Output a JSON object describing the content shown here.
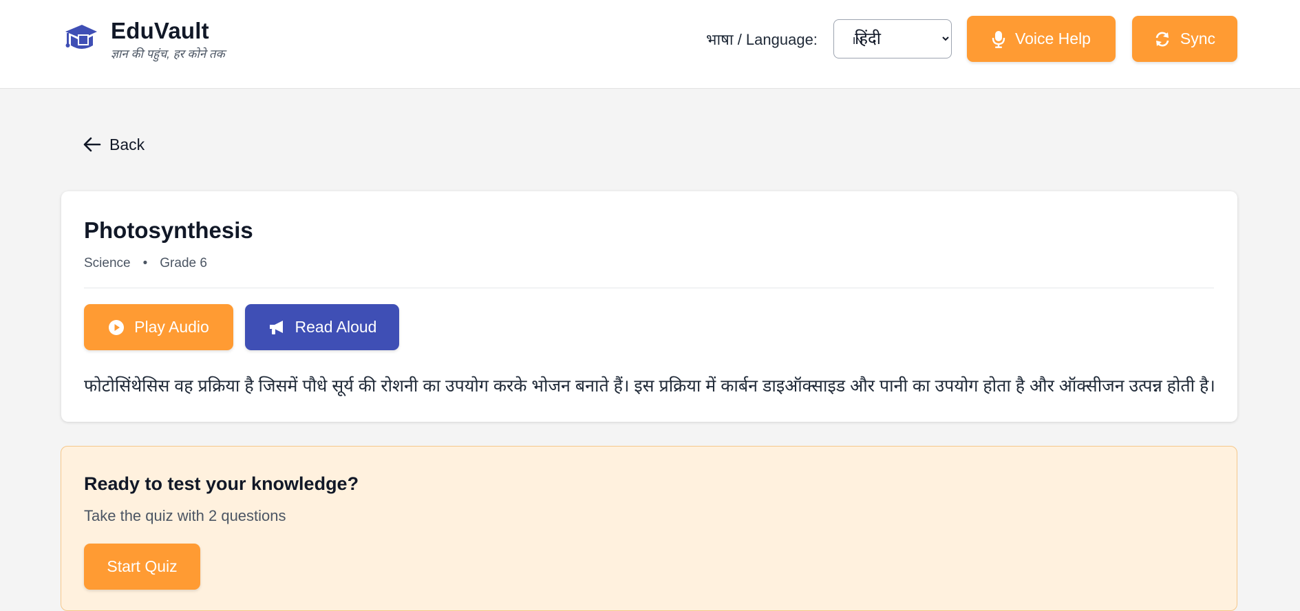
{
  "header": {
    "brand_name": "EduVault",
    "brand_tagline": "ज्ञान की पहुंच, हर कोने तक",
    "language_label": "भाषा / Language:",
    "language_flag": "IN",
    "language_selected": "हिंदी",
    "voice_help_label": "Voice Help",
    "sync_label": "Sync"
  },
  "nav": {
    "back_label": "Back"
  },
  "lesson": {
    "title": "Photosynthesis",
    "subject": "Science",
    "separator": "•",
    "grade": "Grade 6",
    "play_audio_label": "Play Audio",
    "read_aloud_label": "Read Aloud",
    "body": "फोटोसिंथेसिस वह प्रक्रिया है जिसमें पौधे सूर्य की रोशनी का उपयोग करके भोजन बनाते हैं। इस प्रक्रिया में कार्बन डाइऑक्साइड और पानी का उपयोग होता है और ऑक्सीजन उत्पन्न होती है।"
  },
  "quiz": {
    "title": "Ready to test your knowledge?",
    "subtitle": "Take the quiz with 2 questions",
    "start_label": "Start Quiz"
  },
  "icons": {
    "logo": "graduation-cap-icon",
    "voice": "microphone-icon",
    "sync": "sync-icon",
    "back": "arrow-left-icon",
    "play": "play-circle-icon",
    "read": "megaphone-icon"
  },
  "colors": {
    "accent_orange": "#ff9b33",
    "accent_indigo": "#3f4fb5",
    "logo_blue": "#3f4fb5",
    "quiz_background": "#fff1de",
    "page_background": "#f4f4f4"
  }
}
